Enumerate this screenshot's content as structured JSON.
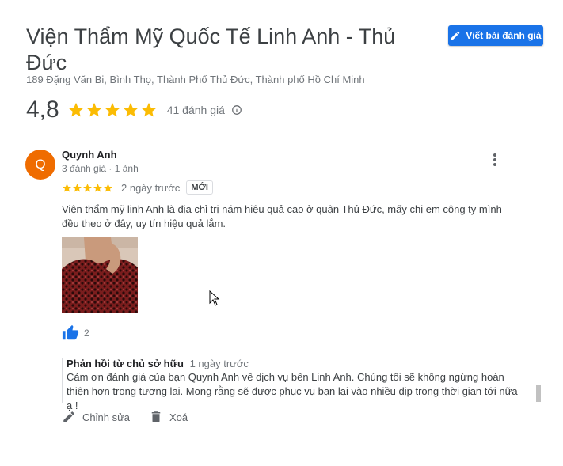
{
  "place": {
    "name": "Viện Thẩm Mỹ Quốc Tế Linh Anh - Thủ Đức",
    "address": "189 Đặng Văn Bi, Bình Thọ, Thành Phố Thủ Đức, Thành phố Hồ Chí Minh"
  },
  "header": {
    "write_review_label": "Viết bài đánh giá"
  },
  "rating": {
    "value": "4,8",
    "stars": 5,
    "count_label": "41 đánh giá"
  },
  "review": {
    "avatar_letter": "Q",
    "avatar_color": "#ef6c00",
    "author": "Quynh Anh",
    "author_meta": "3 đánh giá · 1 ảnh",
    "stars": 5,
    "date": "2 ngày trước",
    "badge": "MỚI",
    "text": "Viện thẩm mỹ linh Anh là địa chỉ trị nám hiệu quả cao ở quận Thủ Đức, mấy chị em công ty mình đều theo ở đây, uy tín hiệu quả lắm.",
    "likes": "2"
  },
  "owner_reply": {
    "label": "Phản hồi từ chủ sở hữu",
    "date": "1 ngày trước",
    "text": "Cảm ơn đánh giá của bạn Quynh Anh về dịch vụ bên Linh Anh. Chúng tôi sẽ không ngừng hoàn thiện hơn trong tương lai. Mong rằng sẽ được phục vụ bạn lại vào nhiều dịp trong thời gian tới nữa ạ !"
  },
  "actions": {
    "edit_label": "Chỉnh sửa",
    "delete_label": "Xoá"
  },
  "colors": {
    "accent": "#1a73e8",
    "star": "#fbbc04",
    "like": "#1a73e8"
  }
}
